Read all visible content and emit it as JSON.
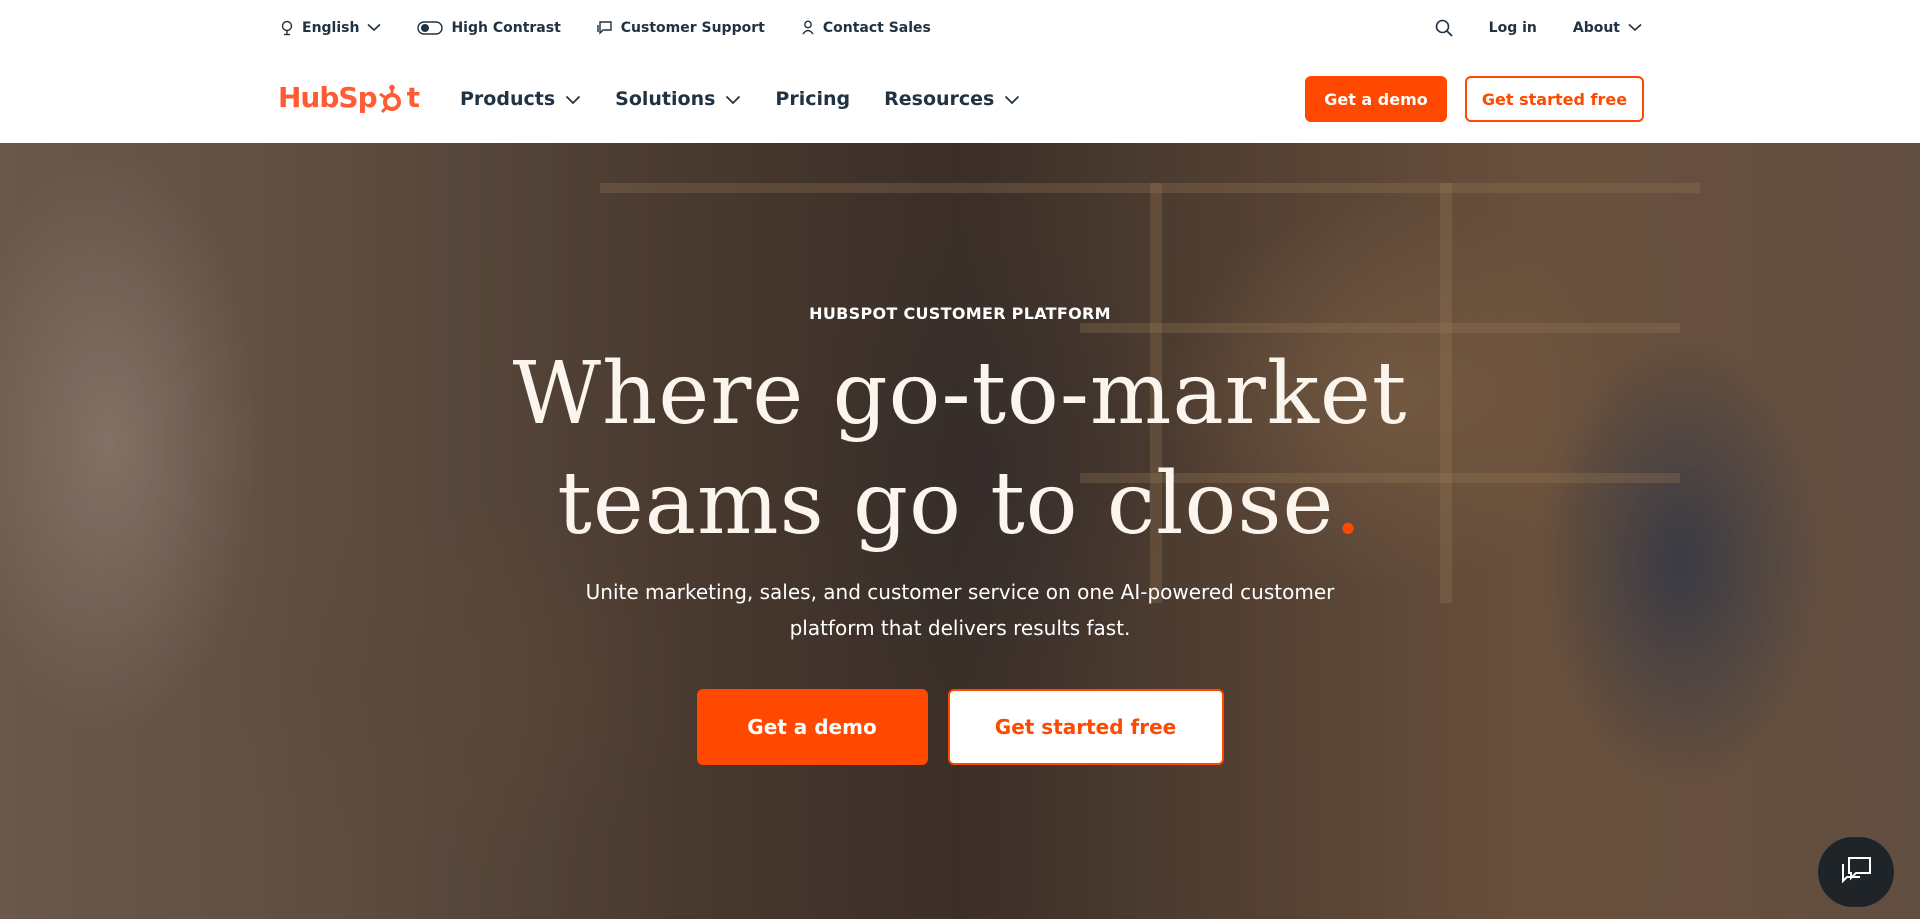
{
  "utility_bar": {
    "language": "English",
    "high_contrast": "High Contrast",
    "customer_support": "Customer Support",
    "contact_sales": "Contact Sales",
    "login": "Log in",
    "about": "About"
  },
  "nav": {
    "logo_text_a": "HubSp",
    "logo_text_b": "t",
    "items": [
      {
        "label": "Products",
        "has_dropdown": true
      },
      {
        "label": "Solutions",
        "has_dropdown": true
      },
      {
        "label": "Pricing",
        "has_dropdown": false
      },
      {
        "label": "Resources",
        "has_dropdown": true
      }
    ],
    "demo_label": "Get a demo",
    "start_label": "Get started free"
  },
  "hero": {
    "eyebrow": "HUBSPOT CUSTOMER PLATFORM",
    "headline_line1": "Where go-to-market",
    "headline_line2": "teams go to close",
    "headline_dot": ".",
    "subhead": "Unite marketing, sales, and customer service on one AI-powered customer platform that delivers results fast.",
    "demo_label": "Get a demo",
    "start_label": "Get started free"
  },
  "colors": {
    "brand": "#ff5c35",
    "cta": "#ff4800",
    "text": "#213343"
  },
  "icons": {
    "language": "globe-icon",
    "contrast": "toggle-icon",
    "support": "chat-bubble-icon",
    "sales": "person-icon",
    "search": "search-icon",
    "chevron": "chevron-down-icon",
    "chat_launcher": "chat-launcher-icon"
  }
}
